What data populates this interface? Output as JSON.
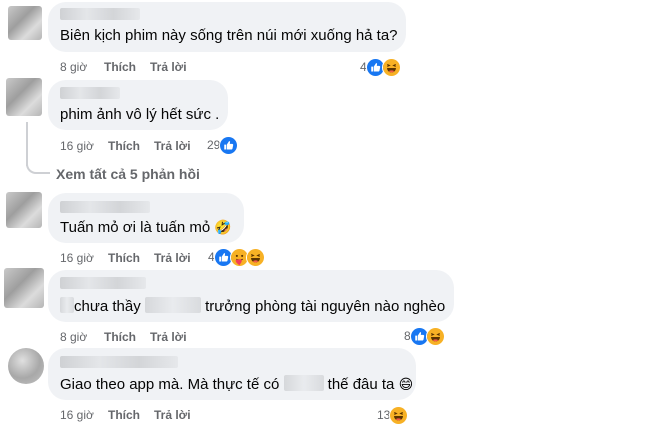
{
  "comments": [
    {
      "text_parts": [
        "Biên kịch phim này sống trên núi mới xuống hả ta?"
      ],
      "time": "8 giờ",
      "like": "Thích",
      "reply": "Trả lời",
      "reaction_count": "4",
      "reactions": [
        "like-icon",
        "haha-icon"
      ]
    },
    {
      "text_parts": [
        "phim ảnh vô lý hết sức ."
      ],
      "time": "16 giờ",
      "like": "Thích",
      "reply": "Trả lời",
      "reaction_count": "29",
      "reactions": [
        "like-icon"
      ]
    },
    {
      "text_parts": [
        "Tuấn mỏ ơi là tuấn mỏ"
      ],
      "emoji": "🤣",
      "time": "16 giờ",
      "like": "Thích",
      "reply": "Trả lời",
      "reaction_count": "4",
      "reactions": [
        "like-icon",
        "care-icon",
        "haha-icon"
      ]
    },
    {
      "text_parts": [
        "chưa thầy",
        "trưởng phòng tài nguyên nào nghèo"
      ],
      "time": "8 giờ",
      "like": "Thích",
      "reply": "Trả lời",
      "reaction_count": "8",
      "reactions": [
        "like-icon",
        "haha-icon"
      ]
    },
    {
      "text_parts": [
        "Giao theo app mà. Mà thực tế có",
        "thế đâu ta"
      ],
      "emoji": "😄",
      "time": "16 giờ",
      "like": "Thích",
      "reply": "Trả lời",
      "reaction_count": "13",
      "reactions": [
        "haha-icon"
      ]
    }
  ],
  "view_replies": "Xem tất cả 5 phản hồi",
  "colors": {
    "bubble": "#f0f2f5",
    "meta": "#65676b",
    "like": "#1877f2",
    "haha": "#f7b125"
  }
}
